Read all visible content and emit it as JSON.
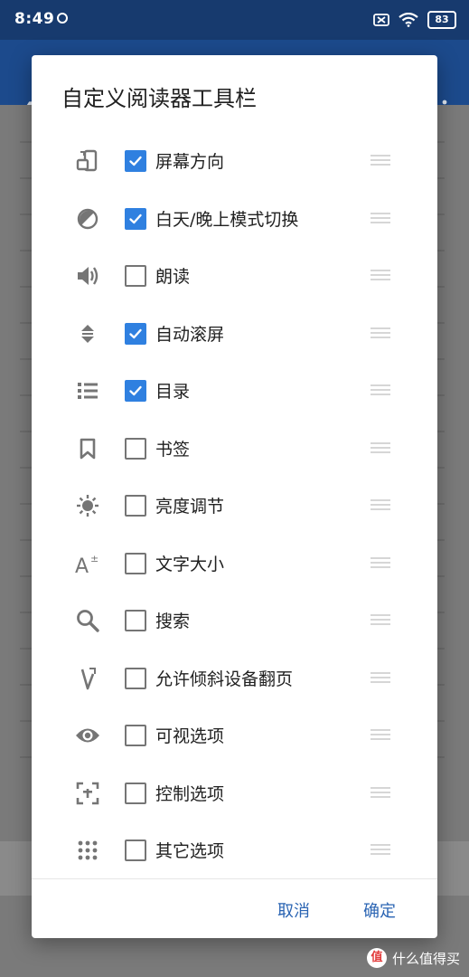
{
  "status_bar": {
    "time": "8:49",
    "battery": "83"
  },
  "dialog": {
    "title": "自定义阅读器工具栏",
    "items": [
      {
        "label": "屏幕方向",
        "icon": "screen-rotation-icon",
        "checked": true
      },
      {
        "label": "白天/晚上模式切换",
        "icon": "day-night-toggle-icon",
        "checked": true
      },
      {
        "label": "朗读",
        "icon": "speaker-icon",
        "checked": false
      },
      {
        "label": "自动滚屏",
        "icon": "auto-scroll-icon",
        "checked": true
      },
      {
        "label": "目录",
        "icon": "list-icon",
        "checked": true
      },
      {
        "label": "书签",
        "icon": "bookmark-icon",
        "checked": false
      },
      {
        "label": "亮度调节",
        "icon": "brightness-icon",
        "checked": false
      },
      {
        "label": "文字大小",
        "icon": "font-size-icon",
        "checked": false
      },
      {
        "label": "搜索",
        "icon": "search-icon",
        "checked": false
      },
      {
        "label": "允许倾斜设备翻页",
        "icon": "tilt-page-icon",
        "checked": false
      },
      {
        "label": "可视选项",
        "icon": "eye-icon",
        "checked": false
      },
      {
        "label": "控制选项",
        "icon": "control-frame-icon",
        "checked": false
      },
      {
        "label": "其它选项",
        "icon": "dots-grid-icon",
        "checked": false
      }
    ],
    "cancel_label": "取消",
    "ok_label": "确定"
  },
  "watermark": {
    "badge": "值",
    "text": "什么值得买"
  },
  "colors": {
    "accent": "#2f80e0",
    "button_text": "#2a64b3",
    "status_bar": "#173a6e",
    "app_bar": "#1c4a8c"
  }
}
